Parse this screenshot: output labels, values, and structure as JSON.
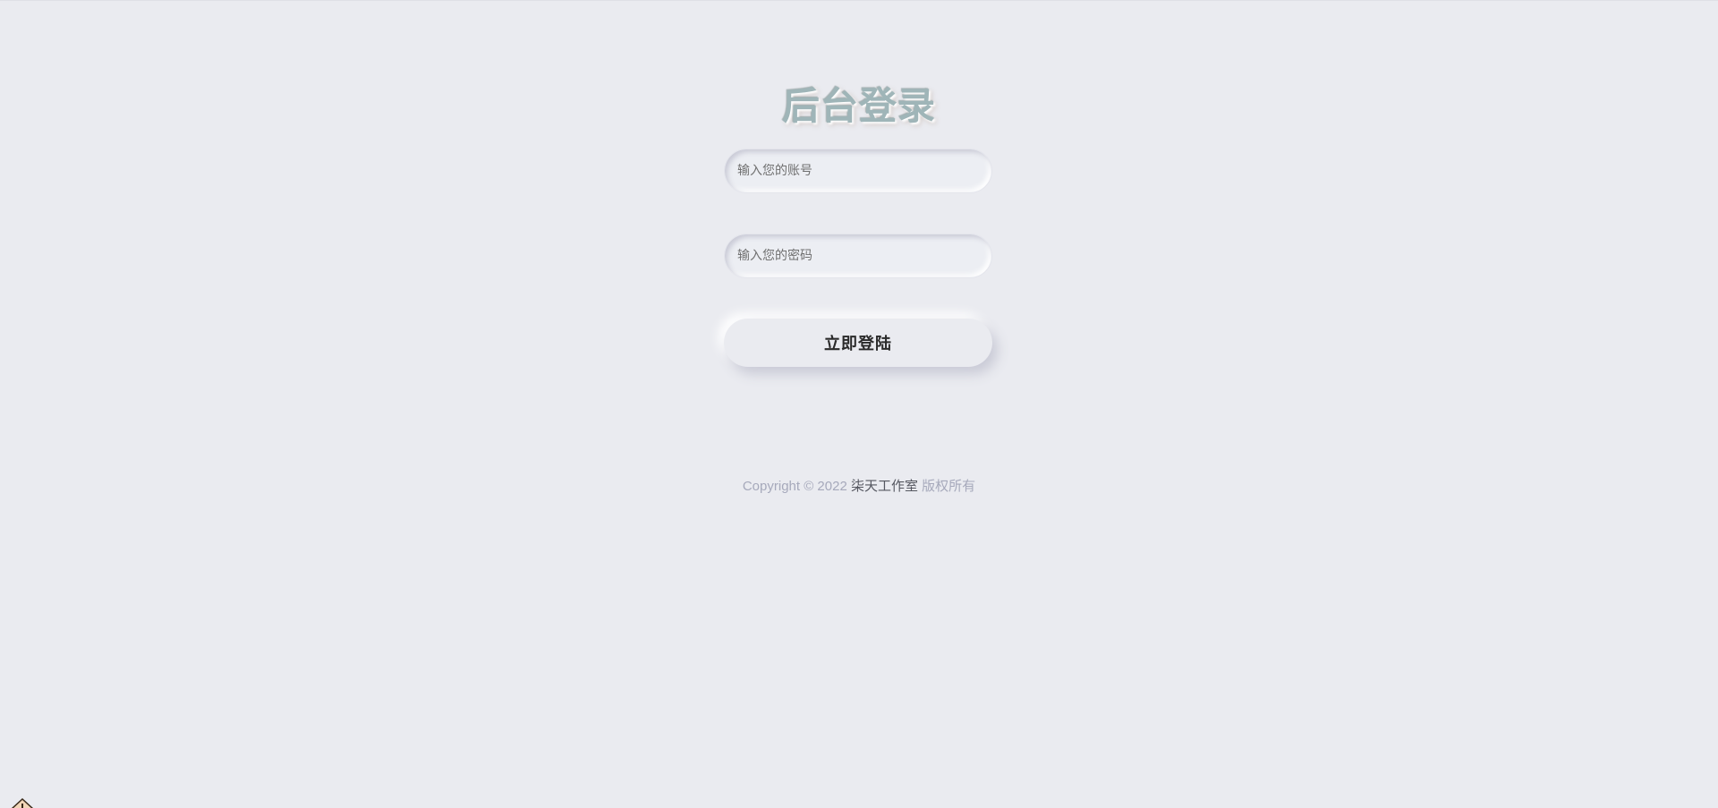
{
  "title": "后台登录",
  "form": {
    "account_placeholder": "输入您的账号",
    "password_placeholder": "输入您的密码",
    "submit_label": "立即登陆"
  },
  "footer": {
    "prefix": "Copyright © 2022 ",
    "studio": "柒天工作室",
    "suffix": " 版权所有"
  },
  "colors": {
    "background": "#eaebf0",
    "title": "#9fb5b8",
    "footer_text": "#a6a9bb",
    "footer_link": "#555760"
  },
  "icons": {
    "corner": "home-icon"
  }
}
